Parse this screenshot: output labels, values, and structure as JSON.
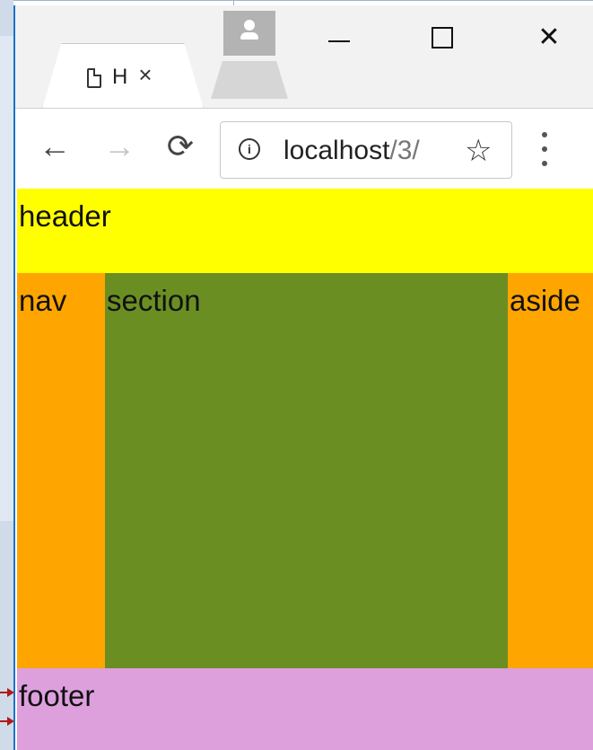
{
  "browser": {
    "tab_title": "H",
    "tab_close_glyph": "×",
    "url_main": "localhost",
    "url_tail": "/3/",
    "icons": {
      "back": "←",
      "forward": "→",
      "reload": "⟳",
      "info": "i",
      "star": "☆",
      "window_close": "✕"
    }
  },
  "page": {
    "header_text": "header",
    "nav_text": "nav",
    "section_text": "section",
    "aside_text": "aside",
    "footer_text": "footer"
  },
  "colors": {
    "header": "#ffff00",
    "nav": "#ffa500",
    "section": "#6b8e23",
    "aside": "#ffa500",
    "footer": "#dda0dd",
    "window_border": "#1a73c8",
    "annotation_arrow": "#b21a1a"
  }
}
